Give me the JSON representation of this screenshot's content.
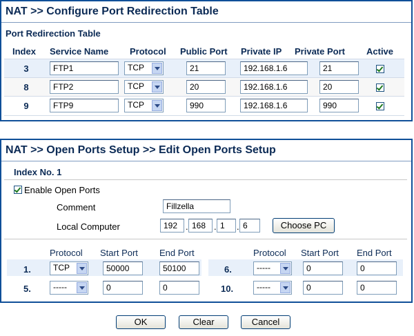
{
  "panel1": {
    "title": "NAT >> Configure Port Redirection Table",
    "section": "Port Redirection Table",
    "headers": [
      "Index",
      "Service Name",
      "Protocol",
      "Public Port",
      "Private IP",
      "Private Port",
      "Active"
    ],
    "rows": [
      {
        "index": "3",
        "service": "FTP1",
        "protocol": "TCP",
        "public_port": "21",
        "private_ip": "192.168.1.6",
        "private_port": "21",
        "active": true
      },
      {
        "index": "8",
        "service": "FTP2",
        "protocol": "TCP",
        "public_port": "20",
        "private_ip": "192.168.1.6",
        "private_port": "20",
        "active": true
      },
      {
        "index": "9",
        "service": "FTP9",
        "protocol": "TCP",
        "public_port": "990",
        "private_ip": "192.168.1.6",
        "private_port": "990",
        "active": true
      }
    ]
  },
  "panel2": {
    "title": "NAT >> Open Ports Setup >> Edit Open Ports Setup",
    "index_label": "Index No. 1",
    "enable_label": "Enable Open Ports",
    "enable_checked": true,
    "comment_label": "Comment",
    "comment_value": "Fillzella",
    "local_computer_label": "Local Computer",
    "ip_parts": [
      "192",
      "168",
      "1",
      "6"
    ],
    "choose_pc": "Choose PC",
    "col_headers": {
      "protocol": "Protocol",
      "start": "Start Port",
      "end": "End Port"
    },
    "ports": [
      {
        "num": "1.",
        "protocol": "TCP",
        "start": "50000",
        "end": "50100"
      },
      {
        "num": "5.",
        "protocol": "-----",
        "start": "0",
        "end": "0"
      },
      {
        "num": "6.",
        "protocol": "-----",
        "start": "0",
        "end": "0"
      },
      {
        "num": "10.",
        "protocol": "-----",
        "start": "0",
        "end": "0"
      }
    ]
  },
  "footer": {
    "ok": "OK",
    "clear": "Clear",
    "cancel": "Cancel"
  }
}
